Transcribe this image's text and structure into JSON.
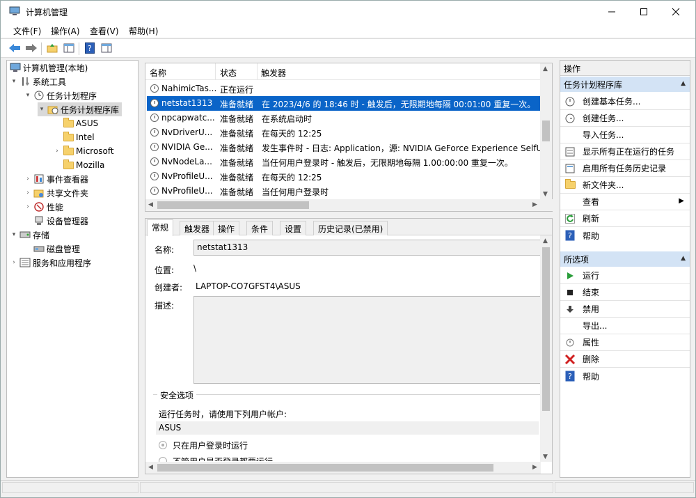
{
  "window": {
    "title": "计算机管理"
  },
  "menu": [
    "文件(F)",
    "操作(A)",
    "查看(V)",
    "帮助(H)"
  ],
  "tree": [
    {
      "label": "计算机管理(本地)",
      "depth": 0,
      "arrow": ""
    },
    {
      "label": "系统工具",
      "depth": 1,
      "arrow": "▾"
    },
    {
      "label": "任务计划程序",
      "depth": 2,
      "arrow": "▾"
    },
    {
      "label": "任务计划程序库",
      "depth": 3,
      "arrow": "▾"
    },
    {
      "label": "ASUS",
      "depth": 4,
      "arrow": ""
    },
    {
      "label": "Intel",
      "depth": 4,
      "arrow": ""
    },
    {
      "label": "Microsoft",
      "depth": 4,
      "arrow": "›"
    },
    {
      "label": "Mozilla",
      "depth": 4,
      "arrow": ""
    },
    {
      "label": "事件查看器",
      "depth": 2,
      "arrow": "›"
    },
    {
      "label": "共享文件夹",
      "depth": 2,
      "arrow": "›"
    },
    {
      "label": "性能",
      "depth": 2,
      "arrow": "›"
    },
    {
      "label": "设备管理器",
      "depth": 2,
      "arrow": ""
    },
    {
      "label": "存储",
      "depth": 1,
      "arrow": "▾"
    },
    {
      "label": "磁盘管理",
      "depth": 2,
      "arrow": ""
    },
    {
      "label": "服务和应用程序",
      "depth": 1,
      "arrow": "›"
    }
  ],
  "list": {
    "headers": [
      "名称",
      "状态",
      "触发器"
    ],
    "rows": [
      {
        "name": "NahimicTas...",
        "status": "正在运行",
        "trigger": ""
      },
      {
        "name": "netstat1313",
        "status": "准备就绪",
        "trigger": "在 2023/4/6 的 18:46 时 - 触发后，无限期地每隔 00:01:00 重复一次。"
      },
      {
        "name": "npcapwatc...",
        "status": "准备就绪",
        "trigger": "在系统启动时"
      },
      {
        "name": "NvDriverU...",
        "status": "准备就绪",
        "trigger": "在每天的 12:25"
      },
      {
        "name": "NVIDIA Ge...",
        "status": "准备就绪",
        "trigger": "发生事件时 - 日志: Application，源: NVIDIA GeForce Experience SelfUp"
      },
      {
        "name": "NvNodeLa...",
        "status": "准备就绪",
        "trigger": "当任何用户登录时 - 触发后，无限期地每隔 1.00:00:00 重复一次。"
      },
      {
        "name": "NvProfileU...",
        "status": "准备就绪",
        "trigger": "在每天的 12:25"
      },
      {
        "name": "NvProfileU...",
        "status": "准备就绪",
        "trigger": "当任何用户登录时"
      }
    ]
  },
  "detail": {
    "tabs": [
      "常规",
      "触发器",
      "操作",
      "条件",
      "设置",
      "历史记录(已禁用)"
    ],
    "name_label": "名称:",
    "name_value": "netstat1313",
    "location_label": "位置:",
    "location_value": "\\",
    "author_label": "创建者:",
    "author_value": "LAPTOP-CO7GFST4\\ASUS",
    "desc_label": "描述:",
    "security_title": "安全选项",
    "run_as_label": "运行任务时，请使用下列用户帐户:",
    "run_as_value": "ASUS",
    "radio1": "只在用户登录时运行",
    "radio2": "不管用户是否登录都要运行"
  },
  "actions": {
    "header": "操作",
    "section1": "任务计划程序库",
    "items1": [
      "创建基本任务...",
      "创建任务...",
      "导入任务...",
      "显示所有正在运行的任务",
      "启用所有任务历史记录",
      "新文件夹...",
      "查看",
      "刷新",
      "帮助"
    ],
    "section2": "所选项",
    "items2": [
      "运行",
      "结束",
      "禁用",
      "导出...",
      "属性",
      "删除",
      "帮助"
    ]
  },
  "colors": {
    "selection": "#0a64c8",
    "section_header": "#d3e3f5"
  }
}
